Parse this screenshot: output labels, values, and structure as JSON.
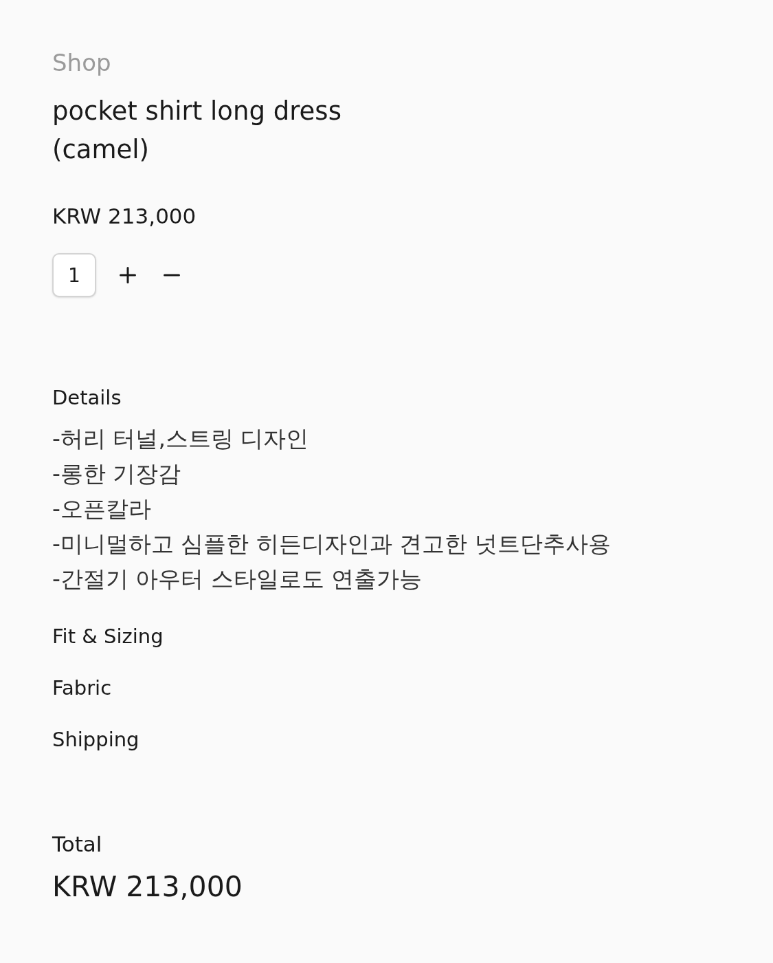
{
  "breadcrumb": "Shop",
  "product": {
    "title_lines": [
      "pocket shirt long dress",
      "(camel)"
    ],
    "price": "KRW 213,000"
  },
  "quantity": {
    "value": "1"
  },
  "details": {
    "heading": "Details",
    "lines": [
      "-허리 터널,스트링 디자인",
      "-롱한 기장감",
      "-오픈칼라",
      "-미니멀하고 심플한 히든디자인과 견고한 넛트단추사용",
      "-간절기 아우터 스타일로도 연출가능"
    ]
  },
  "sections": [
    {
      "label": "Fit & Sizing"
    },
    {
      "label": "Fabric"
    },
    {
      "label": "Shipping"
    }
  ],
  "total": {
    "label": "Total",
    "amount": "KRW 213,000"
  }
}
